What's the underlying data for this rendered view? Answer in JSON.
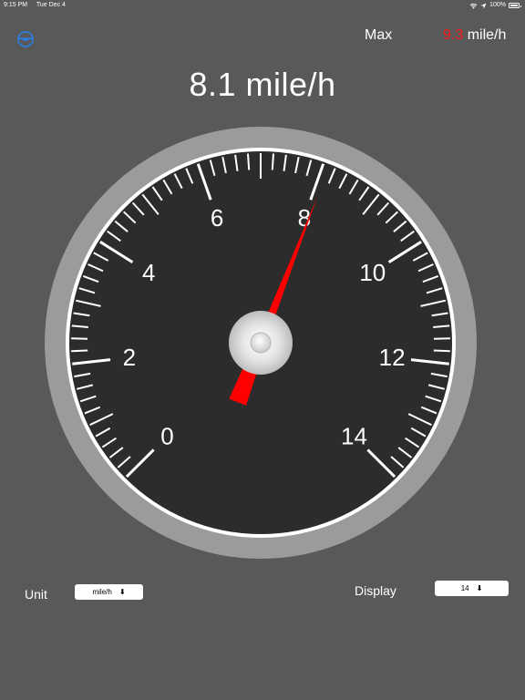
{
  "status_bar": {
    "time": "9:15 PM",
    "date": "Tue Dec 4",
    "battery": "100%"
  },
  "header": {
    "max_label": "Max",
    "max_value": "9.3",
    "max_unit": "mile/h"
  },
  "readout": {
    "speed_text": "8.1 mile/h"
  },
  "gauge": {
    "min": 0,
    "max": 14,
    "value": 8.1,
    "major_labels": [
      "0",
      "2",
      "4",
      "6",
      "8",
      "10",
      "12",
      "14"
    ],
    "needle_color": "#ff0000",
    "face_color": "#2c2c2c",
    "bezel_color": "#9b9b9b"
  },
  "controls": {
    "unit_label": "Unit",
    "unit_value": "mile/h",
    "display_label": "Display",
    "display_value": "14",
    "arrow_glyph": "⬇"
  },
  "colors": {
    "background": "#595959",
    "accent": "#2f7bd9",
    "max_highlight": "#ff1a1a"
  }
}
